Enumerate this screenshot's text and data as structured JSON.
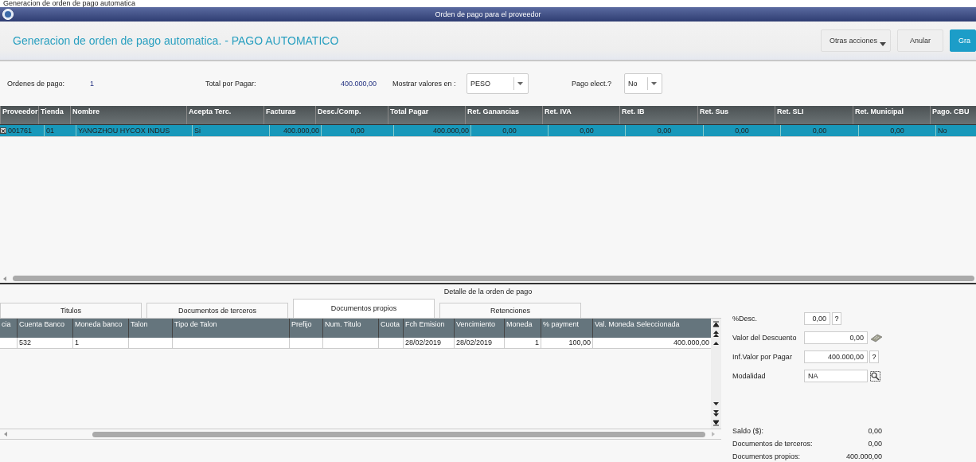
{
  "background_title": "Generacion de orden de pago automatica",
  "window": {
    "title": "Orden de pago para el proveedor"
  },
  "header": {
    "title": "Generacion de orden de pago automatica. - PAGO AUTOMATICO",
    "buttons": [
      {
        "label": "Otras acciones",
        "kind": "menu"
      },
      {
        "label": "Anular",
        "kind": "plain"
      },
      {
        "label": "Gra",
        "kind": "primary"
      }
    ]
  },
  "summary": {
    "orders_label": "Ordenes de pago:",
    "orders_value": "1",
    "total_label": "Total por Pagar:",
    "total_value": "400.000,00",
    "currency_label": "Mostrar valores en :",
    "currency_value": "PESO",
    "electronic_label": "Pago elect.?",
    "electronic_value": "No"
  },
  "orders_table": {
    "columns": [
      "Proveedor",
      "Tienda",
      "Nombre",
      "Acepta Terc.",
      "Facturas",
      "Desc./Comp.",
      "Total Pagar",
      "Ret. Ganancias",
      "Ret. IVA",
      "Ret. IB",
      "Ret. Sus",
      "Ret. SLI",
      "Ret. Municipal",
      "Pago. CBU"
    ],
    "rows": [
      {
        "checked": true,
        "selected": true,
        "cells": [
          "001761",
          "01",
          "YANGZHOU HYCOX INDUS",
          "Si",
          "400.000,00",
          "0,00",
          "400.000,00",
          "0,00",
          "0,00",
          "0,00",
          "0,00",
          "0,00",
          "0,00",
          "No"
        ]
      }
    ]
  },
  "detail": {
    "title": "Detalle de la orden de pago",
    "tabs": [
      {
        "label": "Titulos",
        "selected": false
      },
      {
        "label": "Documentos de terceros",
        "selected": false
      },
      {
        "label": "Documentos propios",
        "selected": true
      },
      {
        "label": "Retenciones",
        "selected": false
      }
    ],
    "columns": [
      "cia",
      "Cuenta Banco",
      "Moneda banco",
      "Talon",
      "Tipo de Talon",
      "Prefijo",
      "Num. Titulo",
      "Cuota",
      "Fch Emision",
      "Vencimiento",
      "Moneda",
      "% payment",
      "Val. Moneda Seleccionada"
    ],
    "rows": [
      [
        "",
        "532",
        "1",
        "",
        "",
        "",
        "",
        "",
        "28/02/2019",
        "28/02/2019",
        "1",
        "100,00",
        "400.000,00"
      ]
    ]
  },
  "fields": [
    {
      "label": "%Desc.",
      "value": "0,00",
      "kind": "help"
    },
    {
      "label": "Valor del Descuento",
      "value": "0,00",
      "kind": "calc"
    },
    {
      "label": "Inf.Valor por Pagar",
      "value": "400.000,00",
      "kind": "help"
    },
    {
      "label": "Modalidad",
      "value": "NA",
      "kind": "lookup"
    }
  ],
  "help_mark": "?",
  "totals": [
    {
      "label": "Saldo ($):",
      "value": "0,00"
    },
    {
      "label": "Documentos de terceros:",
      "value": "0,00"
    },
    {
      "label": "Documentos propios:",
      "value": "400.000,00"
    }
  ]
}
